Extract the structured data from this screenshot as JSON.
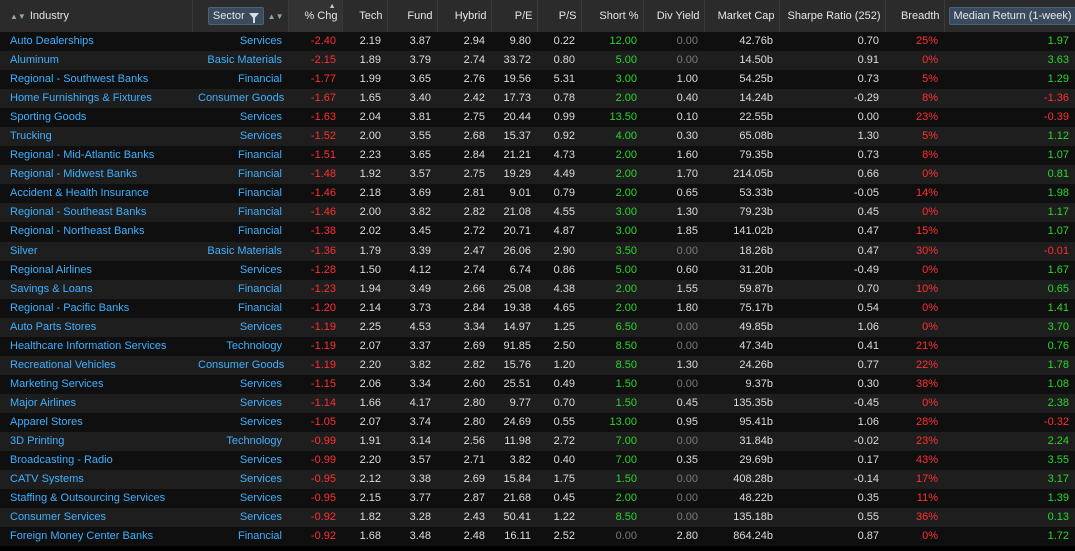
{
  "columns": {
    "industry": "Industry",
    "sector": "Sector",
    "chg": "% Chg",
    "tech": "Tech",
    "fund": "Fund",
    "hybrid": "Hybrid",
    "pe": "P/E",
    "ps": "P/S",
    "short": "Short %",
    "div": "Div Yield",
    "mcap": "Market Cap",
    "sharpe": "Sharpe Ratio (252)",
    "breadth": "Breadth",
    "median": "Median Return (1-week)"
  },
  "rows": [
    {
      "industry": "Auto Dealerships",
      "sector": "Services",
      "chg": "-2.40",
      "tech": "2.19",
      "fund": "3.87",
      "hybrid": "2.94",
      "pe": "9.80",
      "ps": "0.22",
      "short": "12.00",
      "div": "0.00",
      "mcap": "42.76b",
      "sharpe": "0.70",
      "breadth": "25%",
      "median": "1.97"
    },
    {
      "industry": "Aluminum",
      "sector": "Basic Materials",
      "chg": "-2.15",
      "tech": "1.89",
      "fund": "3.79",
      "hybrid": "2.74",
      "pe": "33.72",
      "ps": "0.80",
      "short": "5.00",
      "div": "0.00",
      "mcap": "14.50b",
      "sharpe": "0.91",
      "breadth": "0%",
      "median": "3.63"
    },
    {
      "industry": "Regional - Southwest Banks",
      "sector": "Financial",
      "chg": "-1.77",
      "tech": "1.99",
      "fund": "3.65",
      "hybrid": "2.76",
      "pe": "19.56",
      "ps": "5.31",
      "short": "3.00",
      "div": "1.00",
      "mcap": "54.25b",
      "sharpe": "0.73",
      "breadth": "5%",
      "median": "1.29"
    },
    {
      "industry": "Home Furnishings & Fixtures",
      "sector": "Consumer Goods",
      "chg": "-1.67",
      "tech": "1.65",
      "fund": "3.40",
      "hybrid": "2.42",
      "pe": "17.73",
      "ps": "0.78",
      "short": "2.00",
      "div": "0.40",
      "mcap": "14.24b",
      "sharpe": "-0.29",
      "breadth": "8%",
      "median": "-1.36"
    },
    {
      "industry": "Sporting Goods",
      "sector": "Services",
      "chg": "-1.63",
      "tech": "2.04",
      "fund": "3.81",
      "hybrid": "2.75",
      "pe": "20.44",
      "ps": "0.99",
      "short": "13.50",
      "div": "0.10",
      "mcap": "22.55b",
      "sharpe": "0.00",
      "breadth": "23%",
      "median": "-0.39"
    },
    {
      "industry": "Trucking",
      "sector": "Services",
      "chg": "-1.52",
      "tech": "2.00",
      "fund": "3.55",
      "hybrid": "2.68",
      "pe": "15.37",
      "ps": "0.92",
      "short": "4.00",
      "div": "0.30",
      "mcap": "65.08b",
      "sharpe": "1.30",
      "breadth": "5%",
      "median": "1.12"
    },
    {
      "industry": "Regional - Mid-Atlantic Banks",
      "sector": "Financial",
      "chg": "-1.51",
      "tech": "2.23",
      "fund": "3.65",
      "hybrid": "2.84",
      "pe": "21.21",
      "ps": "4.73",
      "short": "2.00",
      "div": "1.60",
      "mcap": "79.35b",
      "sharpe": "0.73",
      "breadth": "8%",
      "median": "1.07"
    },
    {
      "industry": "Regional - Midwest Banks",
      "sector": "Financial",
      "chg": "-1.48",
      "tech": "1.92",
      "fund": "3.57",
      "hybrid": "2.75",
      "pe": "19.29",
      "ps": "4.49",
      "short": "2.00",
      "div": "1.70",
      "mcap": "214.05b",
      "sharpe": "0.66",
      "breadth": "0%",
      "median": "0.81"
    },
    {
      "industry": "Accident & Health Insurance",
      "sector": "Financial",
      "chg": "-1.46",
      "tech": "2.18",
      "fund": "3.69",
      "hybrid": "2.81",
      "pe": "9.01",
      "ps": "0.79",
      "short": "2.00",
      "div": "0.65",
      "mcap": "53.33b",
      "sharpe": "-0.05",
      "breadth": "14%",
      "median": "1.98"
    },
    {
      "industry": "Regional - Southeast Banks",
      "sector": "Financial",
      "chg": "-1.46",
      "tech": "2.00",
      "fund": "3.82",
      "hybrid": "2.82",
      "pe": "21.08",
      "ps": "4.55",
      "short": "3.00",
      "div": "1.30",
      "mcap": "79.23b",
      "sharpe": "0.45",
      "breadth": "0%",
      "median": "1.17"
    },
    {
      "industry": "Regional - Northeast Banks",
      "sector": "Financial",
      "chg": "-1.38",
      "tech": "2.02",
      "fund": "3.45",
      "hybrid": "2.72",
      "pe": "20.71",
      "ps": "4.87",
      "short": "3.00",
      "div": "1.85",
      "mcap": "141.02b",
      "sharpe": "0.47",
      "breadth": "15%",
      "median": "1.07"
    },
    {
      "industry": "Silver",
      "sector": "Basic Materials",
      "chg": "-1.36",
      "tech": "1.79",
      "fund": "3.39",
      "hybrid": "2.47",
      "pe": "26.06",
      "ps": "2.90",
      "short": "3.50",
      "div": "0.00",
      "mcap": "18.26b",
      "sharpe": "0.47",
      "breadth": "30%",
      "median": "-0.01"
    },
    {
      "industry": "Regional Airlines",
      "sector": "Services",
      "chg": "-1.28",
      "tech": "1.50",
      "fund": "4.12",
      "hybrid": "2.74",
      "pe": "6.74",
      "ps": "0.86",
      "short": "5.00",
      "div": "0.60",
      "mcap": "31.20b",
      "sharpe": "-0.49",
      "breadth": "0%",
      "median": "1.67"
    },
    {
      "industry": "Savings & Loans",
      "sector": "Financial",
      "chg": "-1.23",
      "tech": "1.94",
      "fund": "3.49",
      "hybrid": "2.66",
      "pe": "25.08",
      "ps": "4.38",
      "short": "2.00",
      "div": "1.55",
      "mcap": "59.87b",
      "sharpe": "0.70",
      "breadth": "10%",
      "median": "0.65"
    },
    {
      "industry": "Regional - Pacific Banks",
      "sector": "Financial",
      "chg": "-1.20",
      "tech": "2.14",
      "fund": "3.73",
      "hybrid": "2.84",
      "pe": "19.38",
      "ps": "4.65",
      "short": "2.00",
      "div": "1.80",
      "mcap": "75.17b",
      "sharpe": "0.54",
      "breadth": "0%",
      "median": "1.41"
    },
    {
      "industry": "Auto Parts Stores",
      "sector": "Services",
      "chg": "-1.19",
      "tech": "2.25",
      "fund": "4.53",
      "hybrid": "3.34",
      "pe": "14.97",
      "ps": "1.25",
      "short": "6.50",
      "div": "0.00",
      "mcap": "49.85b",
      "sharpe": "1.06",
      "breadth": "0%",
      "median": "3.70"
    },
    {
      "industry": "Healthcare Information Services",
      "sector": "Technology",
      "chg": "-1.19",
      "tech": "2.07",
      "fund": "3.37",
      "hybrid": "2.69",
      "pe": "91.85",
      "ps": "2.50",
      "short": "8.50",
      "div": "0.00",
      "mcap": "47.34b",
      "sharpe": "0.41",
      "breadth": "21%",
      "median": "0.76"
    },
    {
      "industry": "Recreational Vehicles",
      "sector": "Consumer Goods",
      "chg": "-1.19",
      "tech": "2.20",
      "fund": "3.82",
      "hybrid": "2.82",
      "pe": "15.76",
      "ps": "1.20",
      "short": "8.50",
      "div": "1.30",
      "mcap": "24.26b",
      "sharpe": "0.77",
      "breadth": "22%",
      "median": "1.78"
    },
    {
      "industry": "Marketing Services",
      "sector": "Services",
      "chg": "-1.15",
      "tech": "2.06",
      "fund": "3.34",
      "hybrid": "2.60",
      "pe": "25.51",
      "ps": "0.49",
      "short": "1.50",
      "div": "0.00",
      "mcap": "9.37b",
      "sharpe": "0.30",
      "breadth": "38%",
      "median": "1.08"
    },
    {
      "industry": "Major Airlines",
      "sector": "Services",
      "chg": "-1.14",
      "tech": "1.66",
      "fund": "4.17",
      "hybrid": "2.80",
      "pe": "9.77",
      "ps": "0.70",
      "short": "1.50",
      "div": "0.45",
      "mcap": "135.35b",
      "sharpe": "-0.45",
      "breadth": "0%",
      "median": "2.38"
    },
    {
      "industry": "Apparel Stores",
      "sector": "Services",
      "chg": "-1.05",
      "tech": "2.07",
      "fund": "3.74",
      "hybrid": "2.80",
      "pe": "24.69",
      "ps": "0.55",
      "short": "13.00",
      "div": "0.95",
      "mcap": "95.41b",
      "sharpe": "1.06",
      "breadth": "28%",
      "median": "-0.32"
    },
    {
      "industry": "3D Printing",
      "sector": "Technology",
      "chg": "-0.99",
      "tech": "1.91",
      "fund": "3.14",
      "hybrid": "2.56",
      "pe": "11.98",
      "ps": "2.72",
      "short": "7.00",
      "div": "0.00",
      "mcap": "31.84b",
      "sharpe": "-0.02",
      "breadth": "23%",
      "median": "2.24"
    },
    {
      "industry": "Broadcasting - Radio",
      "sector": "Services",
      "chg": "-0.99",
      "tech": "2.20",
      "fund": "3.57",
      "hybrid": "2.71",
      "pe": "3.82",
      "ps": "0.40",
      "short": "7.00",
      "div": "0.35",
      "mcap": "29.69b",
      "sharpe": "0.17",
      "breadth": "43%",
      "median": "3.55"
    },
    {
      "industry": "CATV Systems",
      "sector": "Services",
      "chg": "-0.95",
      "tech": "2.12",
      "fund": "3.38",
      "hybrid": "2.69",
      "pe": "15.84",
      "ps": "1.75",
      "short": "1.50",
      "div": "0.00",
      "mcap": "408.28b",
      "sharpe": "-0.14",
      "breadth": "17%",
      "median": "3.17"
    },
    {
      "industry": "Staffing & Outsourcing Services",
      "sector": "Services",
      "chg": "-0.95",
      "tech": "2.15",
      "fund": "3.77",
      "hybrid": "2.87",
      "pe": "21.68",
      "ps": "0.45",
      "short": "2.00",
      "div": "0.00",
      "mcap": "48.22b",
      "sharpe": "0.35",
      "breadth": "11%",
      "median": "1.39"
    },
    {
      "industry": "Consumer Services",
      "sector": "Services",
      "chg": "-0.92",
      "tech": "1.82",
      "fund": "3.28",
      "hybrid": "2.43",
      "pe": "50.41",
      "ps": "1.22",
      "short": "8.50",
      "div": "0.00",
      "mcap": "135.18b",
      "sharpe": "0.55",
      "breadth": "36%",
      "median": "0.13"
    },
    {
      "industry": "Foreign Money Center Banks",
      "sector": "Financial",
      "chg": "-0.92",
      "tech": "1.68",
      "fund": "3.48",
      "hybrid": "2.48",
      "pe": "16.11",
      "ps": "2.52",
      "short": "0.00",
      "div": "2.80",
      "mcap": "864.24b",
      "sharpe": "0.87",
      "breadth": "0%",
      "median": "1.72"
    }
  ],
  "colors": {
    "negative": "#ff3030",
    "positive": "#2bd62b",
    "link": "#3fb0ff",
    "muted": "#7a7a7a"
  }
}
